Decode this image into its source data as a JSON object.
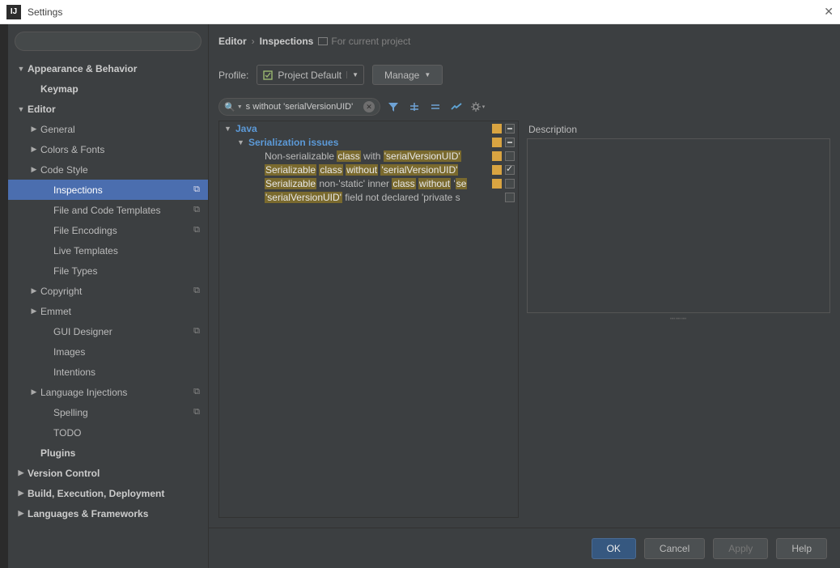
{
  "window": {
    "title": "Settings",
    "app_icon_label": "IJ"
  },
  "breadcrumb": {
    "parent": "Editor",
    "current": "Inspections",
    "scope": "For current project"
  },
  "sidebar": {
    "search_placeholder": "",
    "items": [
      {
        "label": "Appearance & Behavior",
        "arrow": "down",
        "indent": 0,
        "bold": true
      },
      {
        "label": "Keymap",
        "arrow": "none",
        "indent": 1,
        "bold": true
      },
      {
        "label": "Editor",
        "arrow": "down",
        "indent": 0,
        "bold": true
      },
      {
        "label": "General",
        "arrow": "right",
        "indent": 1
      },
      {
        "label": "Colors & Fonts",
        "arrow": "right",
        "indent": 1
      },
      {
        "label": "Code Style",
        "arrow": "right",
        "indent": 1
      },
      {
        "label": "Inspections",
        "arrow": "none",
        "indent": 2,
        "selected": true,
        "badge": "⧉"
      },
      {
        "label": "File and Code Templates",
        "arrow": "none",
        "indent": 2,
        "badge": "⧉"
      },
      {
        "label": "File Encodings",
        "arrow": "none",
        "indent": 2,
        "badge": "⧉"
      },
      {
        "label": "Live Templates",
        "arrow": "none",
        "indent": 2
      },
      {
        "label": "File Types",
        "arrow": "none",
        "indent": 2
      },
      {
        "label": "Copyright",
        "arrow": "right",
        "indent": 1,
        "badge": "⧉"
      },
      {
        "label": "Emmet",
        "arrow": "right",
        "indent": 1
      },
      {
        "label": "GUI Designer",
        "arrow": "none",
        "indent": 2,
        "badge": "⧉"
      },
      {
        "label": "Images",
        "arrow": "none",
        "indent": 2
      },
      {
        "label": "Intentions",
        "arrow": "none",
        "indent": 2
      },
      {
        "label": "Language Injections",
        "arrow": "right",
        "indent": 1,
        "badge": "⧉"
      },
      {
        "label": "Spelling",
        "arrow": "none",
        "indent": 2,
        "badge": "⧉"
      },
      {
        "label": "TODO",
        "arrow": "none",
        "indent": 2
      },
      {
        "label": "Plugins",
        "arrow": "none",
        "indent": 1,
        "bold": true
      },
      {
        "label": "Version Control",
        "arrow": "right",
        "indent": 0,
        "bold": true
      },
      {
        "label": "Build, Execution, Deployment",
        "arrow": "right",
        "indent": 0,
        "bold": true
      },
      {
        "label": "Languages & Frameworks",
        "arrow": "right",
        "indent": 0,
        "bold": true
      }
    ]
  },
  "profile": {
    "label": "Profile:",
    "value": "Project Default",
    "manage": "Manage"
  },
  "inspection": {
    "search_text": "s without 'serialVersionUID'",
    "tree": {
      "root": "Java",
      "group": "Serialization issues",
      "rows": [
        {
          "pre": "Non-serializable ",
          "h1": "class",
          "mid1": " with ",
          "h2": "'serialVersionUID'",
          "sev": "warn",
          "checked": false
        },
        {
          "pre": "",
          "h1": "Serializable",
          "mid1": " ",
          "h2": "class",
          "mid2": " ",
          "h3": "without",
          "mid3": " ",
          "h4": "'serialVersionUID'",
          "sev": "warn",
          "checked": true
        },
        {
          "pre": "",
          "h1": "Serializable",
          "mid1": " non-'static' inner ",
          "h2": "class",
          "mid2": " ",
          "h3": "without",
          "mid3": " '",
          "h4": "se",
          "sev": "warn",
          "checked": false
        },
        {
          "pre": "",
          "h1": "'serialVersionUID'",
          "mid1": " field not declared 'private s",
          "sev": "",
          "checked": false
        }
      ]
    },
    "description_label": "Description"
  },
  "footer": {
    "ok": "OK",
    "cancel": "Cancel",
    "apply": "Apply",
    "help": "Help"
  }
}
